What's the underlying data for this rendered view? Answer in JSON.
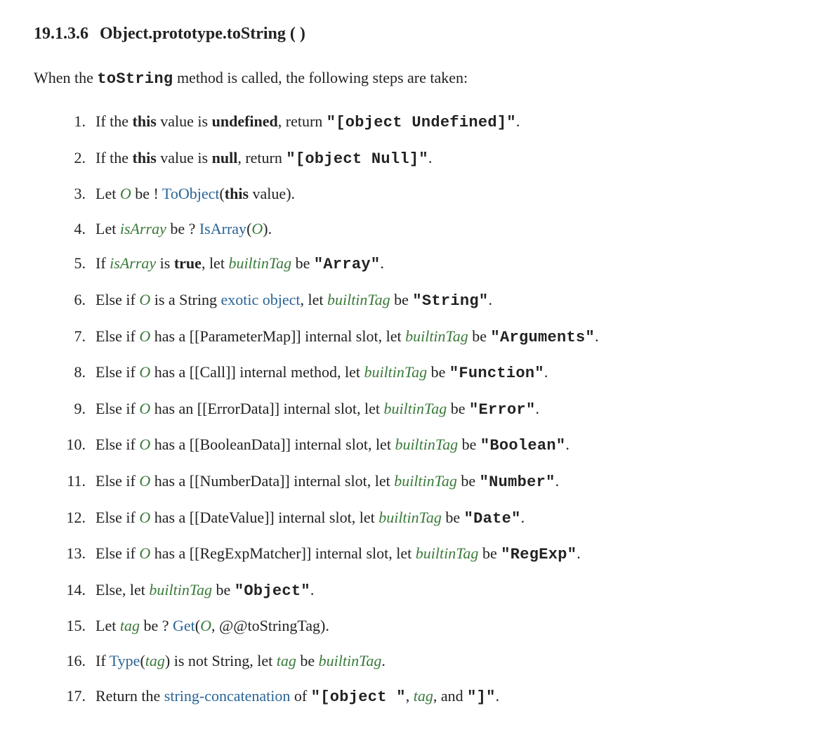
{
  "heading": {
    "number": "19.1.3.6",
    "title": "Object.prototype.toString ( )"
  },
  "intro": {
    "prefix": "When the ",
    "method": "toString",
    "suffix": " method is called, the following steps are taken:"
  },
  "steps": [
    {
      "parts": [
        {
          "t": "text",
          "v": "If the "
        },
        {
          "t": "bold",
          "v": "this"
        },
        {
          "t": "text",
          "v": " value is "
        },
        {
          "t": "bold",
          "v": "undefined"
        },
        {
          "t": "text",
          "v": ", return "
        },
        {
          "t": "code",
          "v": "\"[object Undefined]\""
        },
        {
          "t": "text",
          "v": "."
        }
      ]
    },
    {
      "parts": [
        {
          "t": "text",
          "v": "If the "
        },
        {
          "t": "bold",
          "v": "this"
        },
        {
          "t": "text",
          "v": " value is "
        },
        {
          "t": "bold",
          "v": "null"
        },
        {
          "t": "text",
          "v": ", return "
        },
        {
          "t": "code",
          "v": "\"[object Null]\""
        },
        {
          "t": "text",
          "v": "."
        }
      ]
    },
    {
      "parts": [
        {
          "t": "text",
          "v": "Let "
        },
        {
          "t": "var",
          "v": "O"
        },
        {
          "t": "text",
          "v": " be ! "
        },
        {
          "t": "link",
          "v": "ToObject"
        },
        {
          "t": "text",
          "v": "("
        },
        {
          "t": "bold",
          "v": "this"
        },
        {
          "t": "text",
          "v": " value)."
        }
      ]
    },
    {
      "parts": [
        {
          "t": "text",
          "v": "Let "
        },
        {
          "t": "var",
          "v": "isArray"
        },
        {
          "t": "text",
          "v": " be ? "
        },
        {
          "t": "link",
          "v": "IsArray"
        },
        {
          "t": "text",
          "v": "("
        },
        {
          "t": "var",
          "v": "O"
        },
        {
          "t": "text",
          "v": ")."
        }
      ]
    },
    {
      "parts": [
        {
          "t": "text",
          "v": "If "
        },
        {
          "t": "var",
          "v": "isArray"
        },
        {
          "t": "text",
          "v": " is "
        },
        {
          "t": "bold",
          "v": "true"
        },
        {
          "t": "text",
          "v": ", let "
        },
        {
          "t": "var",
          "v": "builtinTag"
        },
        {
          "t": "text",
          "v": " be "
        },
        {
          "t": "code",
          "v": "\"Array\""
        },
        {
          "t": "text",
          "v": "."
        }
      ]
    },
    {
      "parts": [
        {
          "t": "text",
          "v": "Else if "
        },
        {
          "t": "var",
          "v": "O"
        },
        {
          "t": "text",
          "v": " is a String "
        },
        {
          "t": "link",
          "v": "exotic object"
        },
        {
          "t": "text",
          "v": ", let "
        },
        {
          "t": "var",
          "v": "builtinTag"
        },
        {
          "t": "text",
          "v": " be "
        },
        {
          "t": "code",
          "v": "\"String\""
        },
        {
          "t": "text",
          "v": "."
        }
      ]
    },
    {
      "parts": [
        {
          "t": "text",
          "v": "Else if "
        },
        {
          "t": "var",
          "v": "O"
        },
        {
          "t": "text",
          "v": " has a [[ParameterMap]] internal slot, let "
        },
        {
          "t": "var",
          "v": "builtinTag"
        },
        {
          "t": "text",
          "v": " be "
        },
        {
          "t": "code",
          "v": "\"Arguments\""
        },
        {
          "t": "text",
          "v": "."
        }
      ]
    },
    {
      "parts": [
        {
          "t": "text",
          "v": "Else if "
        },
        {
          "t": "var",
          "v": "O"
        },
        {
          "t": "text",
          "v": " has a [[Call]] internal method, let "
        },
        {
          "t": "var",
          "v": "builtinTag"
        },
        {
          "t": "text",
          "v": " be "
        },
        {
          "t": "code",
          "v": "\"Function\""
        },
        {
          "t": "text",
          "v": "."
        }
      ]
    },
    {
      "parts": [
        {
          "t": "text",
          "v": "Else if "
        },
        {
          "t": "var",
          "v": "O"
        },
        {
          "t": "text",
          "v": " has an [[ErrorData]] internal slot, let "
        },
        {
          "t": "var",
          "v": "builtinTag"
        },
        {
          "t": "text",
          "v": " be "
        },
        {
          "t": "code",
          "v": "\"Error\""
        },
        {
          "t": "text",
          "v": "."
        }
      ]
    },
    {
      "parts": [
        {
          "t": "text",
          "v": "Else if "
        },
        {
          "t": "var",
          "v": "O"
        },
        {
          "t": "text",
          "v": " has a [[BooleanData]] internal slot, let "
        },
        {
          "t": "var",
          "v": "builtinTag"
        },
        {
          "t": "text",
          "v": " be "
        },
        {
          "t": "code",
          "v": "\"Boolean\""
        },
        {
          "t": "text",
          "v": "."
        }
      ]
    },
    {
      "parts": [
        {
          "t": "text",
          "v": "Else if "
        },
        {
          "t": "var",
          "v": "O"
        },
        {
          "t": "text",
          "v": " has a [[NumberData]] internal slot, let "
        },
        {
          "t": "var",
          "v": "builtinTag"
        },
        {
          "t": "text",
          "v": " be "
        },
        {
          "t": "code",
          "v": "\"Number\""
        },
        {
          "t": "text",
          "v": "."
        }
      ]
    },
    {
      "parts": [
        {
          "t": "text",
          "v": "Else if "
        },
        {
          "t": "var",
          "v": "O"
        },
        {
          "t": "text",
          "v": " has a [[DateValue]] internal slot, let "
        },
        {
          "t": "var",
          "v": "builtinTag"
        },
        {
          "t": "text",
          "v": " be "
        },
        {
          "t": "code",
          "v": "\"Date\""
        },
        {
          "t": "text",
          "v": "."
        }
      ]
    },
    {
      "parts": [
        {
          "t": "text",
          "v": "Else if "
        },
        {
          "t": "var",
          "v": "O"
        },
        {
          "t": "text",
          "v": " has a [[RegExpMatcher]] internal slot, let "
        },
        {
          "t": "var",
          "v": "builtinTag"
        },
        {
          "t": "text",
          "v": " be "
        },
        {
          "t": "code",
          "v": "\"RegExp\""
        },
        {
          "t": "text",
          "v": "."
        }
      ]
    },
    {
      "parts": [
        {
          "t": "text",
          "v": "Else, let "
        },
        {
          "t": "var",
          "v": "builtinTag"
        },
        {
          "t": "text",
          "v": " be "
        },
        {
          "t": "code",
          "v": "\"Object\""
        },
        {
          "t": "text",
          "v": "."
        }
      ]
    },
    {
      "parts": [
        {
          "t": "text",
          "v": "Let "
        },
        {
          "t": "var",
          "v": "tag"
        },
        {
          "t": "text",
          "v": " be ? "
        },
        {
          "t": "link",
          "v": "Get"
        },
        {
          "t": "text",
          "v": "("
        },
        {
          "t": "var",
          "v": "O"
        },
        {
          "t": "text",
          "v": ", @@toStringTag)."
        }
      ]
    },
    {
      "parts": [
        {
          "t": "text",
          "v": "If "
        },
        {
          "t": "link",
          "v": "Type"
        },
        {
          "t": "text",
          "v": "("
        },
        {
          "t": "var",
          "v": "tag"
        },
        {
          "t": "text",
          "v": ") is not String, let "
        },
        {
          "t": "var",
          "v": "tag"
        },
        {
          "t": "text",
          "v": " be "
        },
        {
          "t": "var",
          "v": "builtinTag"
        },
        {
          "t": "text",
          "v": "."
        }
      ]
    },
    {
      "parts": [
        {
          "t": "text",
          "v": "Return the "
        },
        {
          "t": "link",
          "v": "string-concatenation"
        },
        {
          "t": "text",
          "v": " of "
        },
        {
          "t": "code",
          "v": "\"[object \""
        },
        {
          "t": "text",
          "v": ", "
        },
        {
          "t": "var",
          "v": "tag"
        },
        {
          "t": "text",
          "v": ", and "
        },
        {
          "t": "code",
          "v": "\"]\""
        },
        {
          "t": "text",
          "v": "."
        }
      ]
    }
  ]
}
